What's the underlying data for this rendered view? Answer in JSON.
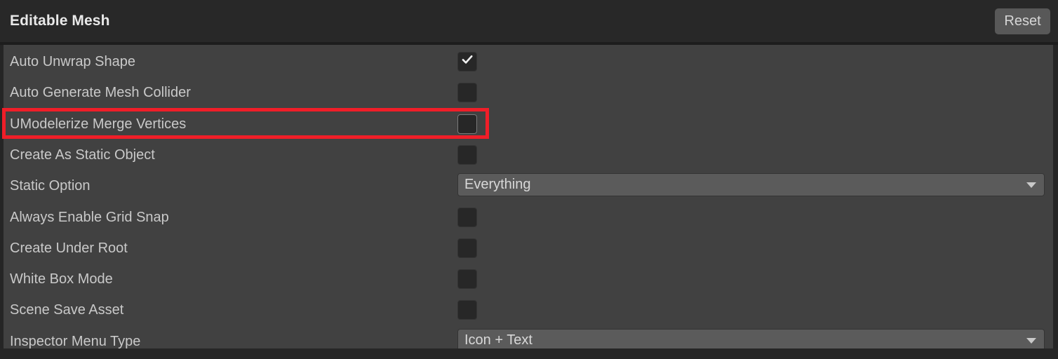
{
  "header": {
    "title": "Editable Mesh",
    "reset_label": "Reset"
  },
  "colors": {
    "header_bg": "#282828",
    "body_bg": "#414141",
    "label_text": "#c9c9c9",
    "title_text": "#e9e9e9",
    "checkbox_bg": "#272727",
    "dropdown_bg": "#5b5b5b",
    "highlight_red": "#f01e28",
    "reset_button_bg": "#585858"
  },
  "rows": [
    {
      "label": "Auto Unwrap Shape",
      "type": "checkbox",
      "checked": true,
      "highlighted": false
    },
    {
      "label": "Auto Generate Mesh Collider",
      "type": "checkbox",
      "checked": false,
      "highlighted": false
    },
    {
      "label": "UModelerize Merge Vertices",
      "type": "checkbox",
      "checked": false,
      "highlighted": true
    },
    {
      "label": "Create As Static Object",
      "type": "checkbox",
      "checked": false,
      "highlighted": false
    },
    {
      "label": "Static Option",
      "type": "dropdown",
      "value": "Everything",
      "highlighted": false
    },
    {
      "label": "Always Enable Grid Snap",
      "type": "checkbox",
      "checked": false,
      "highlighted": false
    },
    {
      "label": "Create Under Root",
      "type": "checkbox",
      "checked": false,
      "highlighted": false
    },
    {
      "label": "White Box Mode",
      "type": "checkbox",
      "checked": false,
      "highlighted": false
    },
    {
      "label": "Scene Save Asset",
      "type": "checkbox",
      "checked": false,
      "highlighted": false
    },
    {
      "label": "Inspector Menu Type",
      "type": "dropdown",
      "value": "Icon + Text",
      "highlighted": false
    }
  ],
  "annotation": {
    "target_row_index": 2,
    "color": "#f01e28"
  }
}
